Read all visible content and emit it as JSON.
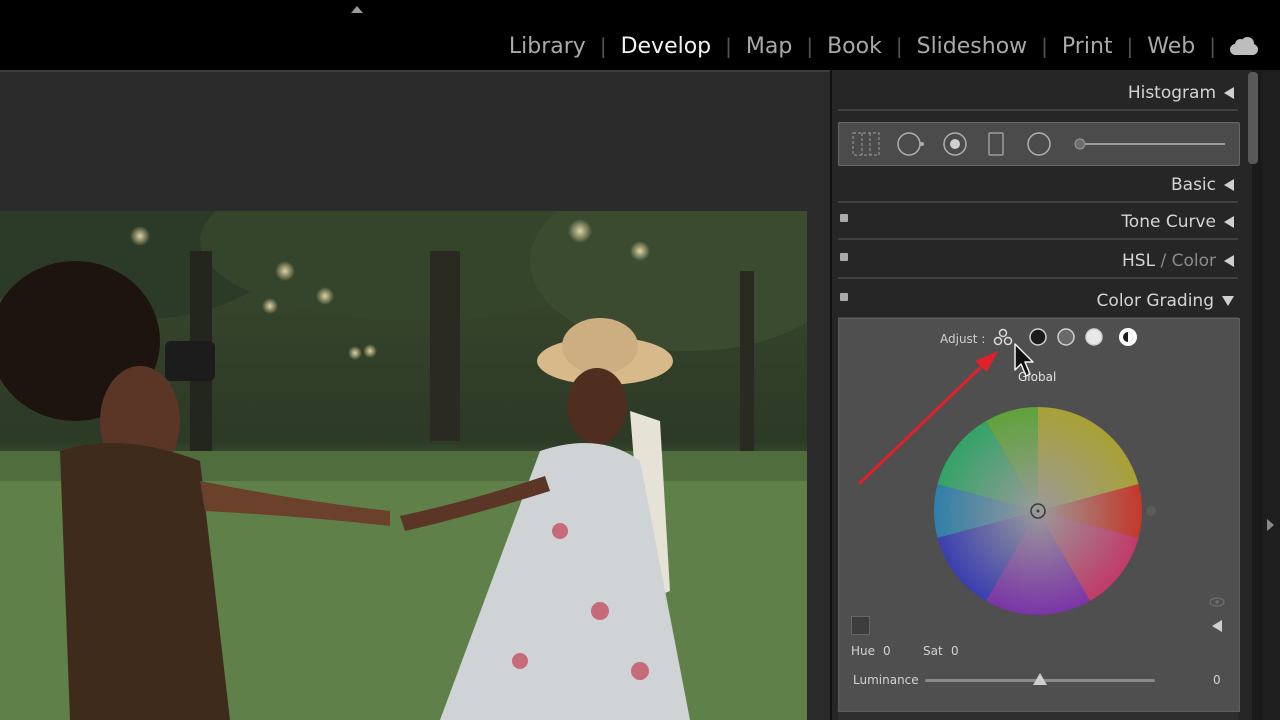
{
  "top_nav": {
    "modules": [
      "Library",
      "Develop",
      "Map",
      "Book",
      "Slideshow",
      "Print",
      "Web"
    ],
    "active": "Develop",
    "cloud_icon": "cloud-icon"
  },
  "right_panel": {
    "histogram": {
      "label": "Histogram"
    },
    "basic": {
      "label": "Basic"
    },
    "tone_curve": {
      "label": "Tone Curve"
    },
    "hsl": {
      "label_hsl": "HSL",
      "label_sep": " / ",
      "label_color": "Color"
    },
    "color_grading": {
      "label": "Color Grading",
      "adjust_label": "Adjust :",
      "mode_tooltip": "Global",
      "hue_label": "Hue",
      "hue_value": "0",
      "sat_label": "Sat",
      "sat_value": "0",
      "luminance_label": "Luminance",
      "luminance_value": "0",
      "luminance_level": 0.5
    }
  },
  "colors": {
    "annotation_arrow": "#e0202a",
    "panel_bg": "#262626",
    "section_bg": "#4f4f4f"
  }
}
